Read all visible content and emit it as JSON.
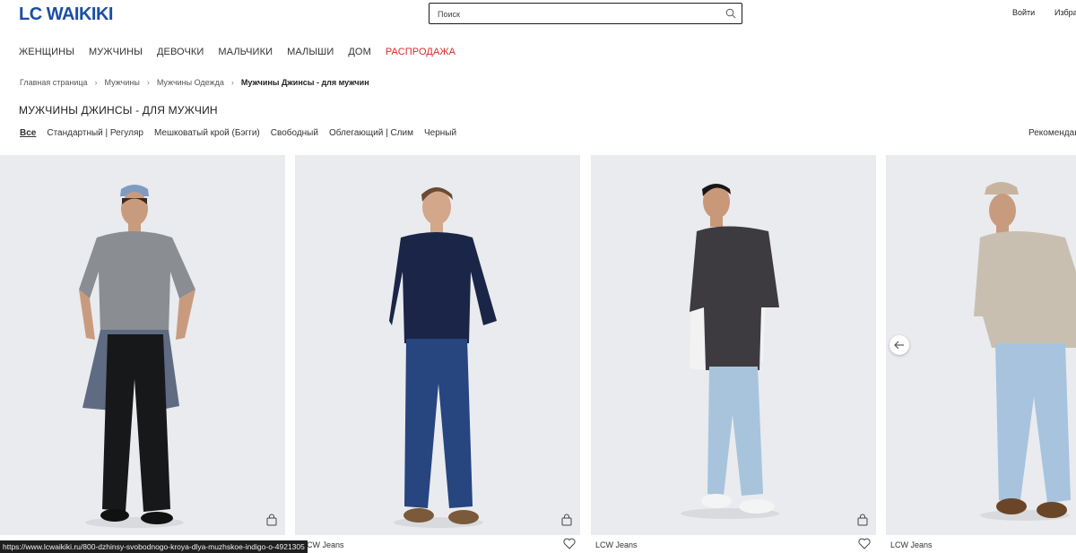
{
  "header": {
    "logo": "LC WAIKIKI",
    "search_placeholder": "Поиск",
    "login": "Войти",
    "favorites": "Избра"
  },
  "nav": [
    "ЖЕНЩИНЫ",
    "МУЖЧИНЫ",
    "ДЕВОЧКИ",
    "МАЛЬЧИКИ",
    "МАЛЫШИ",
    "ДОМ",
    "РАСПРОДАЖА"
  ],
  "breadcrumb": [
    "Главная страница",
    "Мужчины",
    "Мужчины Одежда",
    "Мужчины Джинсы - для мужчин"
  ],
  "page_title": "МУЖЧИНЫ ДЖИНСЫ - ДЛЯ МУЖЧИН",
  "filters": [
    "Все",
    "Стандартный | Регуляр",
    "Мешковатый крой (Бэгги)",
    "Свободный",
    "Облегающий | Слим",
    "Черный"
  ],
  "sort_label": "Рекомендации",
  "products": [
    {
      "brand": "LCW Jeans"
    },
    {
      "brand": "LCW Jeans"
    },
    {
      "brand": "LCW Jeans"
    },
    {
      "brand": "LCW Jeans"
    }
  ],
  "status_url": "https://www.lcwaikiki.ru/800-dzhinsy-svobodnogo-kroya-dlya-muzhskoe-indigo-o-4921305",
  "colors": {
    "brand_blue": "#1a4ea6",
    "sale_red": "#d62b2b",
    "card_bg": "#e9ebee"
  }
}
